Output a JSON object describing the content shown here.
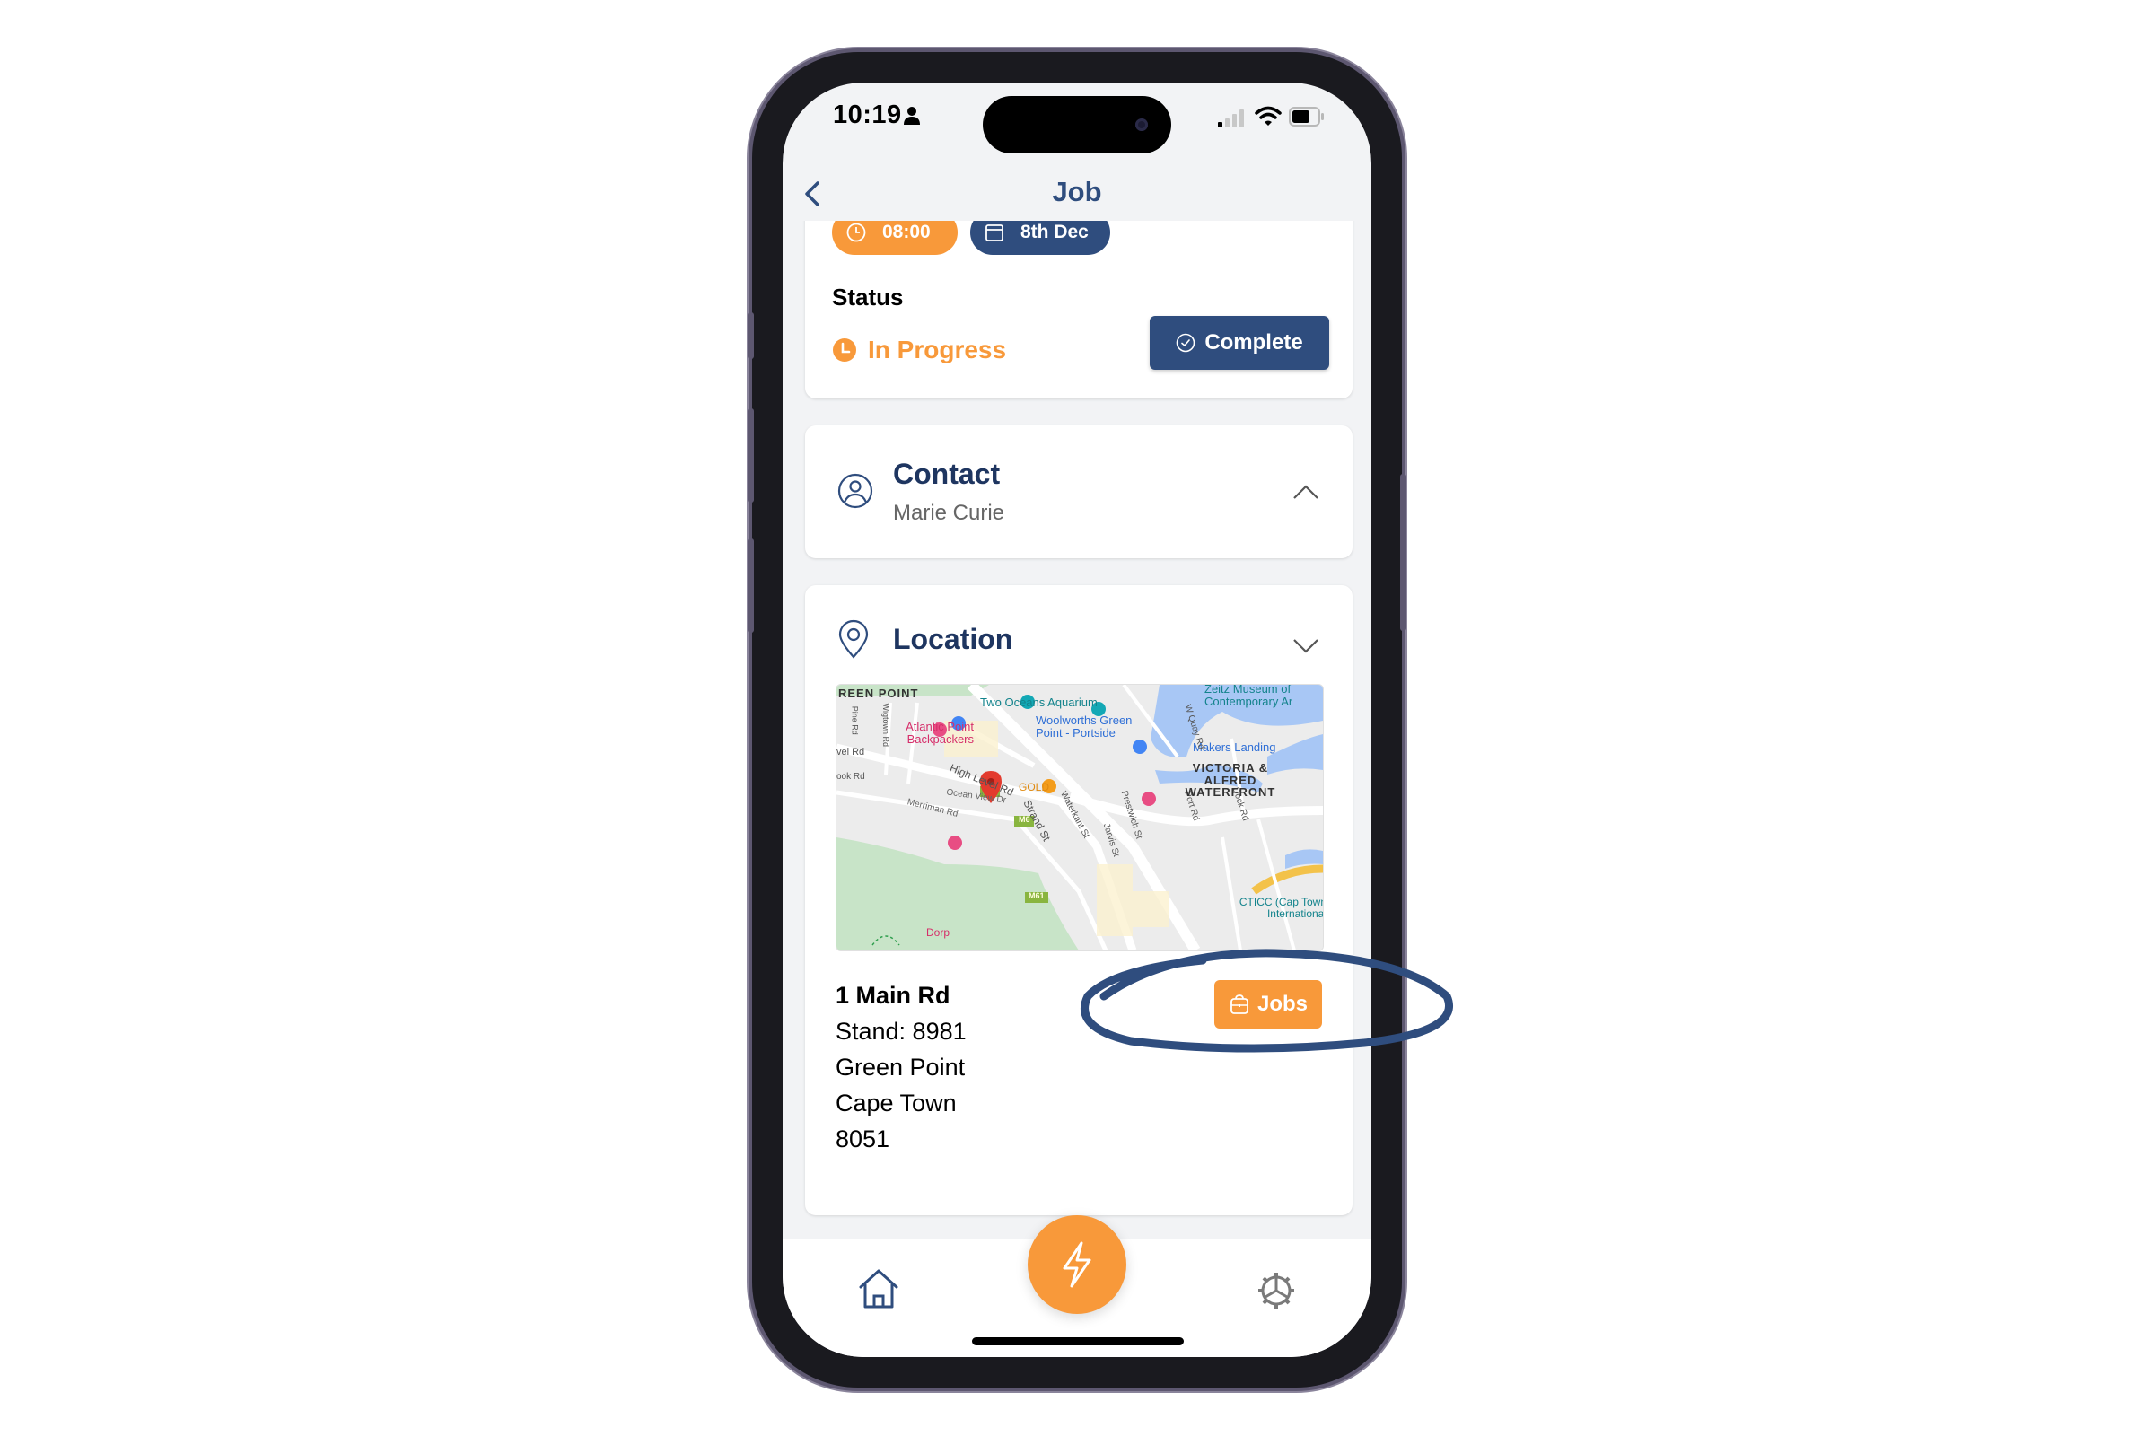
{
  "status_bar": {
    "time": "10:19",
    "icons": [
      "person-icon",
      "cellular-signal-icon",
      "wifi-icon",
      "battery-icon"
    ]
  },
  "header": {
    "title": "Job",
    "back_icon": "chevron-left-icon"
  },
  "job_card": {
    "time_pill": "08:00",
    "date_pill": "8th Dec",
    "status_label": "Status",
    "status_value": "In Progress",
    "complete_button": "Complete"
  },
  "contact": {
    "title": "Contact",
    "name": "Marie Curie",
    "expanded": false
  },
  "location": {
    "title": "Location",
    "expanded": true,
    "address": {
      "street": "1 Main Rd",
      "stand": "Stand: 8981",
      "suburb": "Green Point",
      "city": "Cape Town",
      "postal_code": "8051"
    },
    "jobs_button": "Jobs",
    "map": {
      "labels": {
        "green_point": "REEN POINT",
        "aquarium": "Two Oceans Aquarium",
        "zeitz": "Zeitz Museum of Contemporary Ar",
        "atlantic": "Atlantic Point Backpackers",
        "woolworths": "Woolworths Green Point - Portside",
        "makers": "Makers Landing",
        "vel_rd": "vel Rd",
        "high_level": "High Level Rd",
        "ook_rd": "ook Rd",
        "ocean_view": "Ocean View Dr",
        "merriman": "Merriman Rd",
        "strand": "Strand St",
        "waterkant": "Waterkant St",
        "prestwich": "Prestwich St",
        "jarvis": "Jarvis St",
        "port_rd": "Port Rd",
        "dock_rd": "Dock Rd",
        "w_quay": "W Quay Rd",
        "pine_rd": "Pine Rd",
        "wigtown": "Wigtown Rd",
        "va_waterfront": "VICTORIA & ALFRED WATERFRONT",
        "gold": "GOLD",
        "ctic": "CTICC (Cap Town International",
        "dorp": "Dorp",
        "m6": "M6",
        "m61": "M61"
      }
    }
  },
  "bottom_nav": {
    "home": "home-icon",
    "action": "lightning-icon",
    "settings": "gear-icon"
  },
  "colors": {
    "primary": "#2f4d7e",
    "accent": "#f8993a",
    "background": "#f2f3f5"
  }
}
